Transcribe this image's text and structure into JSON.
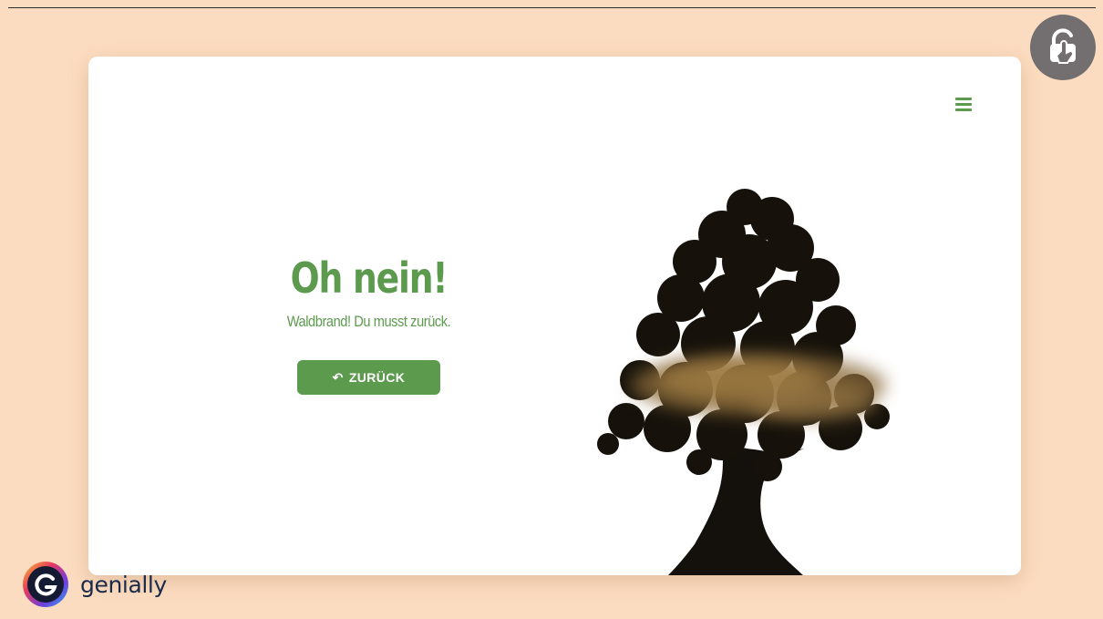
{
  "message": {
    "title": "Oh nein!",
    "subtitle": "Waldbrand! Du musst zurück.",
    "back_button_label": "ZURÜCK",
    "back_button_icon": "undo-icon"
  },
  "header": {
    "menu_icon": "hamburger-menu-icon"
  },
  "overlay": {
    "lock_icon": "unlock-icon"
  },
  "branding": {
    "name": "genially",
    "logo_icon": "genially-logo-icon"
  },
  "colors": {
    "page_background": "#fcdcc0",
    "card_background": "#ffffff",
    "accent_green": "#5c9a4e",
    "lock_button": "#736f70",
    "brand_text": "#1a2a4a"
  }
}
